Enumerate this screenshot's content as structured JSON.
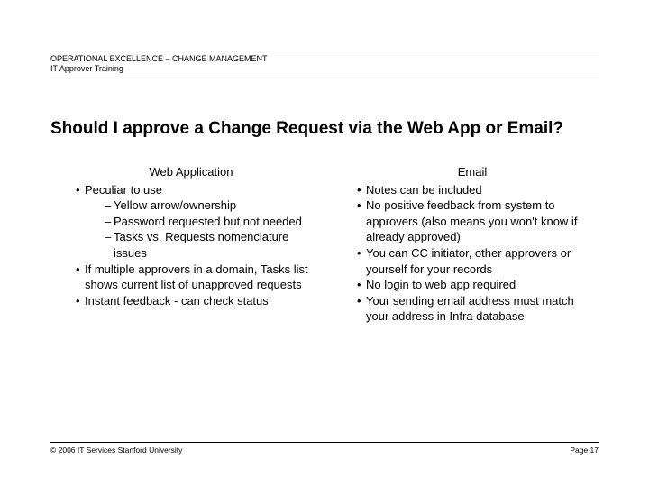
{
  "header": {
    "line1": "OPERATIONAL EXCELLENCE – CHANGE MANAGEMENT",
    "line2": "IT Approver Training"
  },
  "title": "Should I approve a Change Request via the Web App or Email?",
  "left": {
    "heading": "Web Application",
    "b1": "Peculiar to use",
    "b1s1": "Yellow arrow/ownership",
    "b1s2": "Password requested but not needed",
    "b1s3": "Tasks vs. Requests nomenclature issues",
    "b2": "If multiple approvers in a domain, Tasks list shows current list of unapproved requests",
    "b3": "Instant feedback - can check status"
  },
  "right": {
    "heading": "Email",
    "b1": "Notes can be included",
    "b2": "No positive feedback from system to approvers (also means you won't know if already approved)",
    "b3": "You can CC initiator, other approvers or yourself for your records",
    "b4": "No login to web app required",
    "b5": "Your sending email address must match your address in Infra database"
  },
  "footer": {
    "left": "© 2006 IT Services Stanford University",
    "right": "Page 17"
  }
}
